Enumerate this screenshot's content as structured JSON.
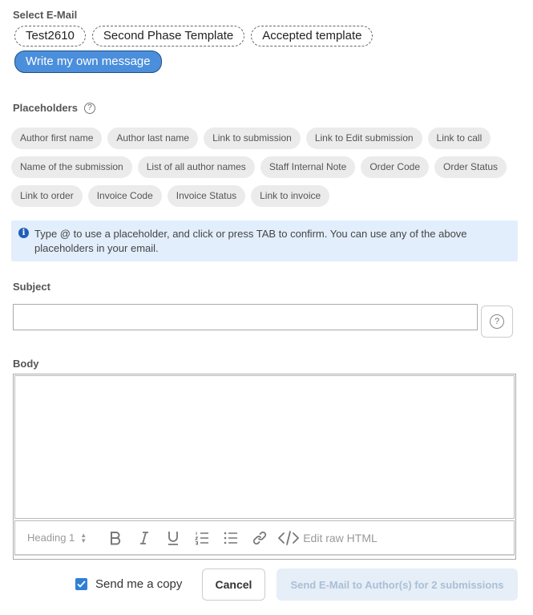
{
  "select_email": {
    "label": "Select E-Mail",
    "templates": [
      {
        "label": "Test2610",
        "selected": false
      },
      {
        "label": "Second Phase Template",
        "selected": false
      },
      {
        "label": "Accepted template",
        "selected": false
      },
      {
        "label": "Write my own message",
        "selected": true
      }
    ]
  },
  "placeholders": {
    "label": "Placeholders",
    "help_glyph": "?",
    "items": [
      "Author first name",
      "Author last name",
      "Link to submission",
      "Link to Edit submission",
      "Link to call",
      "Name of the submission",
      "List of all author names",
      "Staff Internal Note",
      "Order Code",
      "Order Status",
      "Link to order",
      "Invoice Code",
      "Invoice Status",
      "Link to invoice"
    ]
  },
  "info": {
    "icon_glyph": "i",
    "text": "Type @ to use a placeholder, and click or press TAB to confirm. You can use any of the above placeholders in your email."
  },
  "subject": {
    "label": "Subject",
    "value": "",
    "placeholder": "",
    "help_glyph": "?"
  },
  "body": {
    "label": "Body",
    "toolbar": {
      "heading_label": "Heading 1",
      "raw_html_label": "Edit raw HTML",
      "buttons": [
        "bold-icon",
        "italic-icon",
        "underline-icon",
        "numbered-list-icon",
        "bulleted-list-icon",
        "link-icon",
        "code-icon"
      ]
    }
  },
  "footer": {
    "copy_label": "Send me a copy",
    "copy_checked": true,
    "cancel_label": "Cancel",
    "send_label": "Send E-Mail to Author(s) for 2 submissions"
  },
  "colors": {
    "accent": "#4b8fdc",
    "info_bg": "#e3eefc",
    "chip_bg": "#ebebeb",
    "checkbox": "#2f80d6",
    "send_disabled_bg": "#e6eef7"
  }
}
